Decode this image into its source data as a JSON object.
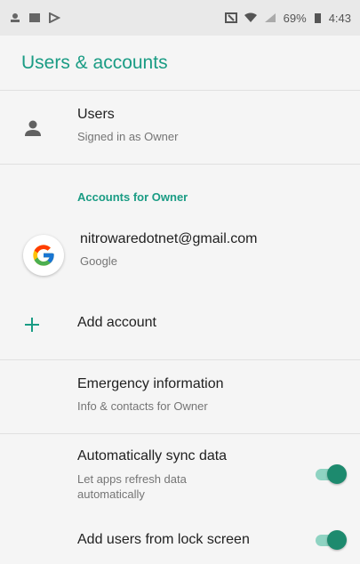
{
  "status_bar": {
    "battery": "69%",
    "time": "4:43",
    "icons": [
      "notification-icon",
      "image-icon",
      "play-store-icon",
      "nfc-icon",
      "wifi-icon",
      "signal-icon",
      "battery-icon"
    ]
  },
  "app_bar": {
    "title": "Users & accounts"
  },
  "users": {
    "title": "Users",
    "subtitle": "Signed in as Owner",
    "icon": "person-icon"
  },
  "accounts_section": {
    "header": "Accounts for Owner"
  },
  "google_account": {
    "email": "nitrowaredotnet@gmail.com",
    "provider": "Google",
    "icon": "google-icon"
  },
  "add_account": {
    "label": "Add account",
    "icon": "plus-icon"
  },
  "emergency": {
    "title": "Emergency information",
    "subtitle": "Info & contacts for Owner"
  },
  "sync": {
    "title": "Automatically sync data",
    "subtitle": "Let apps refresh data automatically",
    "enabled": true
  },
  "add_users": {
    "title": "Add users from lock screen",
    "enabled": true
  },
  "colors": {
    "accent": "#1a9c84",
    "toggle_thumb": "#1d8a6e",
    "toggle_track": "#8fd3c2"
  }
}
